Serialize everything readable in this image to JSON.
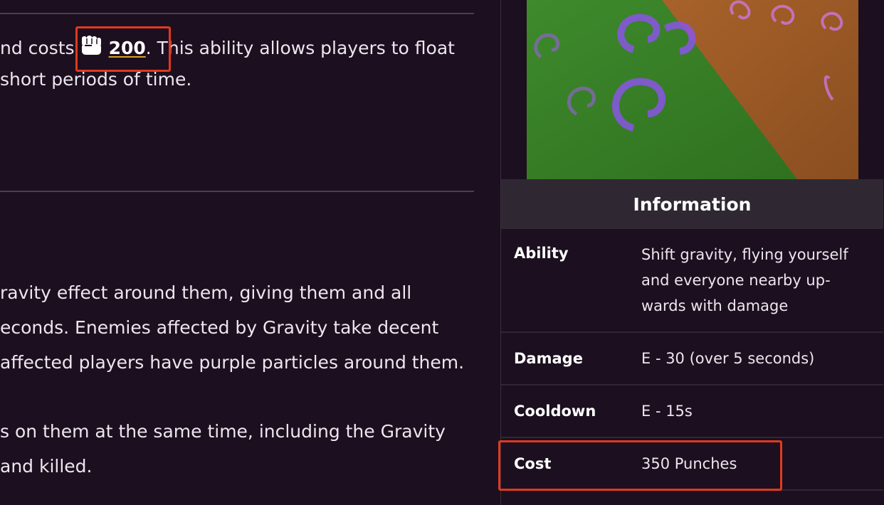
{
  "article": {
    "para1": {
      "before": "nd costs",
      "cost_value": "200",
      "after": ". This ability allows players to float",
      "line2": "short periods of time."
    },
    "para2": [
      "ravity effect around them, giving them and all",
      "econds. Enemies affected by Gravity take decent",
      "affected players have purple particles around them."
    ],
    "para3": [
      "s on them at the same time, including the Gravity",
      "and killed."
    ]
  },
  "infobox": {
    "heading": "Information",
    "rows": [
      {
        "label": "Ability",
        "value": "Shift gravity, flying yourself and everyone nearby up-wards with damage"
      },
      {
        "label": "Damage",
        "value": "E - 30 (over 5 seconds)"
      },
      {
        "label": "Cooldown",
        "value": "E - 15s"
      },
      {
        "label": "Cost",
        "value": "350 Punches"
      }
    ]
  },
  "icons": {
    "currency": "fist-icon"
  },
  "colors": {
    "background": "#1c0f1f",
    "header": "#2f2833",
    "highlight": "#e03a1e",
    "underline": "#d9a02a"
  }
}
